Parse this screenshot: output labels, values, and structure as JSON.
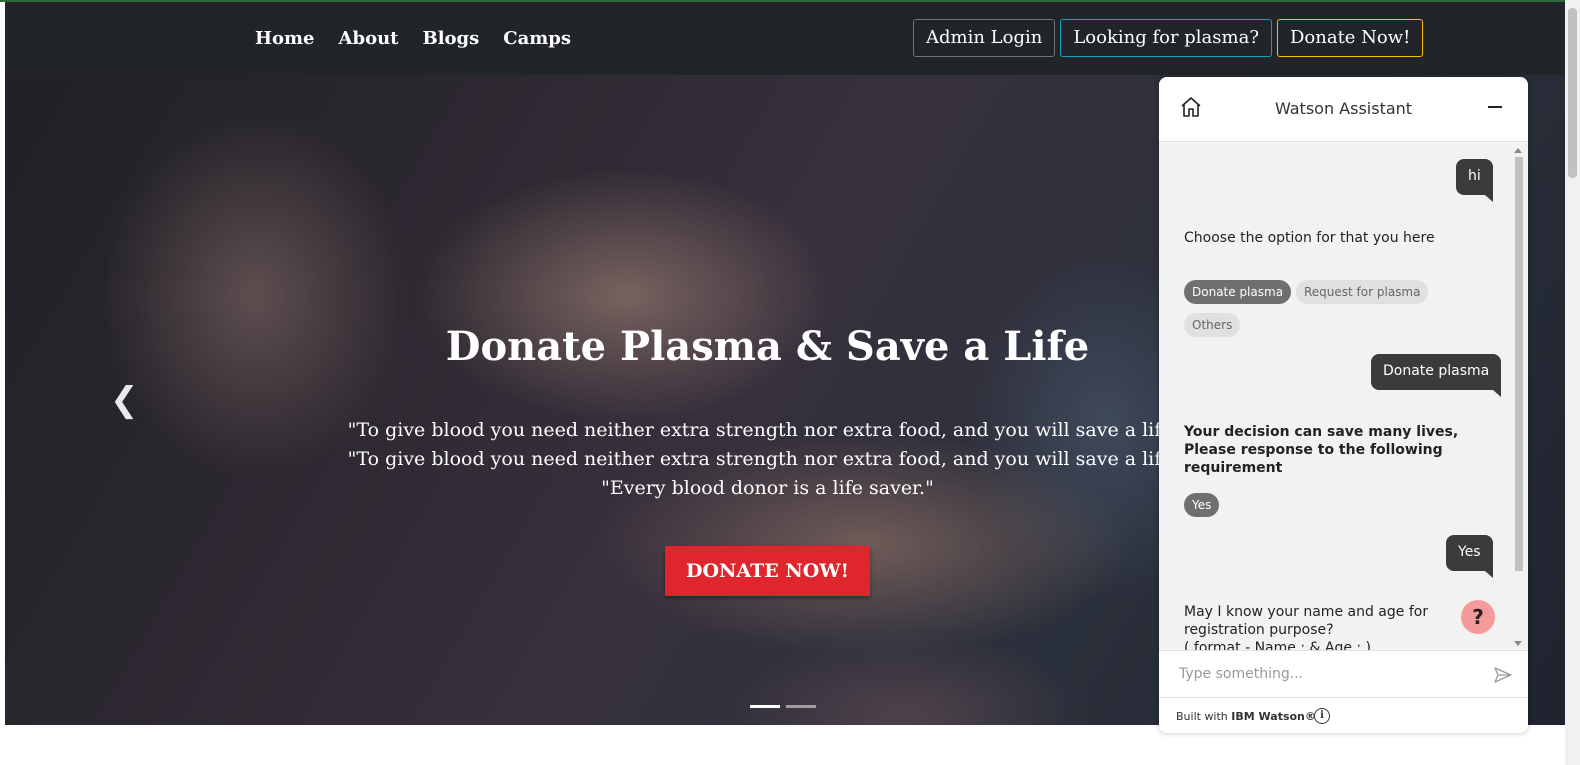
{
  "nav": {
    "links": [
      "Home",
      "About",
      "Blogs",
      "Camps"
    ],
    "admin_login": "Admin Login",
    "looking_for_plasma": "Looking for plasma?",
    "donate_now": "Donate Now!"
  },
  "hero": {
    "title": "Donate Plasma & Save a Life",
    "quotes": [
      "\"To give blood you need neither extra strength nor extra food, and you will save a life.\"",
      "\"To give blood you need neither extra strength nor extra food, and you will save a life.\"",
      "\"Every blood donor is a life saver.\""
    ],
    "cta": "DONATE NOW!",
    "prev_icon": "chevron-left-icon",
    "slides": 2,
    "active_slide": 1
  },
  "chat": {
    "title": "Watson Assistant",
    "messages": [
      {
        "from": "user",
        "text": "hi"
      },
      {
        "from": "bot",
        "text": "Choose the option for that you here"
      },
      {
        "from": "options",
        "items": [
          "Donate plasma",
          "Request for plasma",
          "Others"
        ],
        "selected": "Donate plasma"
      },
      {
        "from": "user",
        "text": "Donate plasma"
      },
      {
        "from": "bot",
        "text": "Your decision can save many lives, Please response to the following requirement"
      },
      {
        "from": "options",
        "items": [
          "Yes"
        ],
        "selected": "Yes"
      },
      {
        "from": "user",
        "text": "Yes"
      },
      {
        "from": "bot",
        "text": "May I know your name and age for registration purpose?"
      },
      {
        "from": "bot",
        "text": "( format - Name : & Age : )"
      }
    ],
    "input_placeholder": "Type something...",
    "footer_prefix": "Built with",
    "footer_brand": "IBM Watson®",
    "help": "?"
  },
  "colors": {
    "navbar": "#212529",
    "donate_button": "#e0262d",
    "chat_user_bubble": "#3b3b3b",
    "help_button": "#f59a9a"
  }
}
